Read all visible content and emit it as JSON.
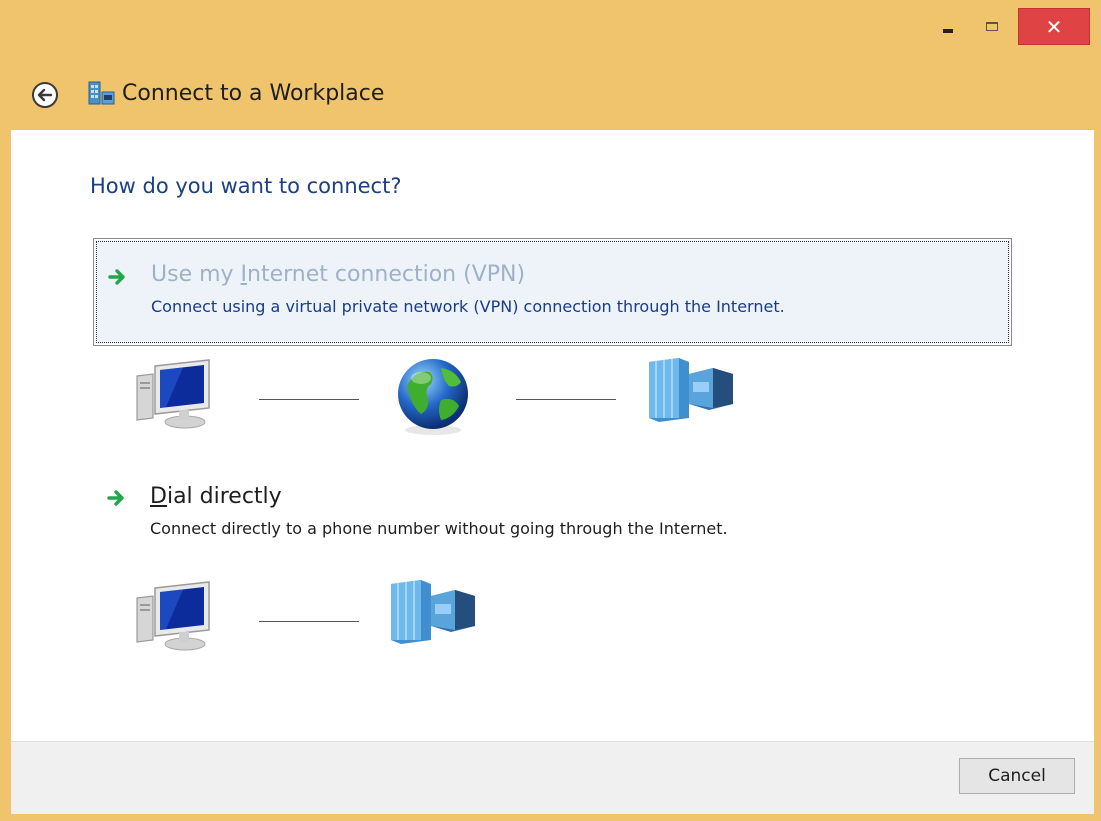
{
  "window": {
    "title": "Connect to a Workplace",
    "controls": {
      "minimize": "minimize-icon",
      "maximize": "maximize-icon",
      "close": "close-icon"
    },
    "accent_color": "#f0c46c",
    "close_color": "#e04343"
  },
  "main": {
    "heading": "How do you want to connect?",
    "options": [
      {
        "title_prefix": "Use my ",
        "title_accel": "I",
        "title_suffix": "nternet connection (VPN)",
        "description": "Connect using a virtual private network (VPN) connection through the Internet.",
        "icons": [
          "computer-icon",
          "globe-icon",
          "office-building-icon"
        ],
        "selected": true
      },
      {
        "title_prefix": "",
        "title_accel": "D",
        "title_suffix": "ial directly",
        "description": "Connect directly to a phone number without going through the Internet.",
        "icons": [
          "computer-icon",
          "office-building-icon"
        ],
        "selected": false
      }
    ]
  },
  "footer": {
    "cancel_label": "Cancel"
  }
}
